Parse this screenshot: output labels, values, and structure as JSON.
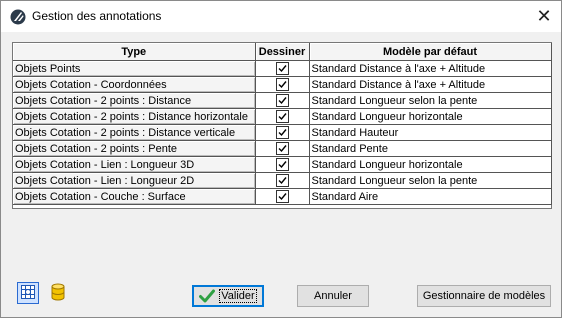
{
  "window": {
    "title": "Gestion des annotations",
    "icon": "app-logo-icon",
    "close_icon": "close-icon"
  },
  "table": {
    "columns": [
      "Type",
      "Dessiner",
      "Modèle par défaut"
    ],
    "rows": [
      {
        "type": "Objets Points",
        "draw": true,
        "model": "Standard Distance à l'axe + Altitude"
      },
      {
        "type": "Objets Cotation - Coordonnées",
        "draw": true,
        "model": "Standard Distance à l'axe + Altitude"
      },
      {
        "type": "Objets Cotation - 2 points : Distance",
        "draw": true,
        "model": "Standard Longueur selon la pente"
      },
      {
        "type": "Objets Cotation - 2 points : Distance horizontale",
        "draw": true,
        "model": "Standard Longueur horizontale"
      },
      {
        "type": "Objets Cotation - 2 points : Distance verticale",
        "draw": true,
        "model": "Standard Hauteur"
      },
      {
        "type": "Objets Cotation - 2 points : Pente",
        "draw": true,
        "model": "Standard Pente"
      },
      {
        "type": "Objets Cotation - Lien : Longueur 3D",
        "draw": true,
        "model": "Standard Longueur horizontale"
      },
      {
        "type": "Objets Cotation - Lien : Longueur 2D",
        "draw": true,
        "model": "Standard Longueur selon la pente"
      },
      {
        "type": "Objets Cotation - Couche : Surface",
        "draw": true,
        "model": "Standard Aire"
      }
    ]
  },
  "toolbar": {
    "grid_icon": "grid-icon",
    "database_icon": "database-icon"
  },
  "buttons": {
    "validate": "Valider",
    "validate_icon": "checkmark-icon",
    "cancel": "Annuler",
    "models": "Gestionnaire de modèles"
  },
  "colors": {
    "checkmark": "#2ea043",
    "accent": "#0078d7",
    "database": "#f2c200"
  }
}
